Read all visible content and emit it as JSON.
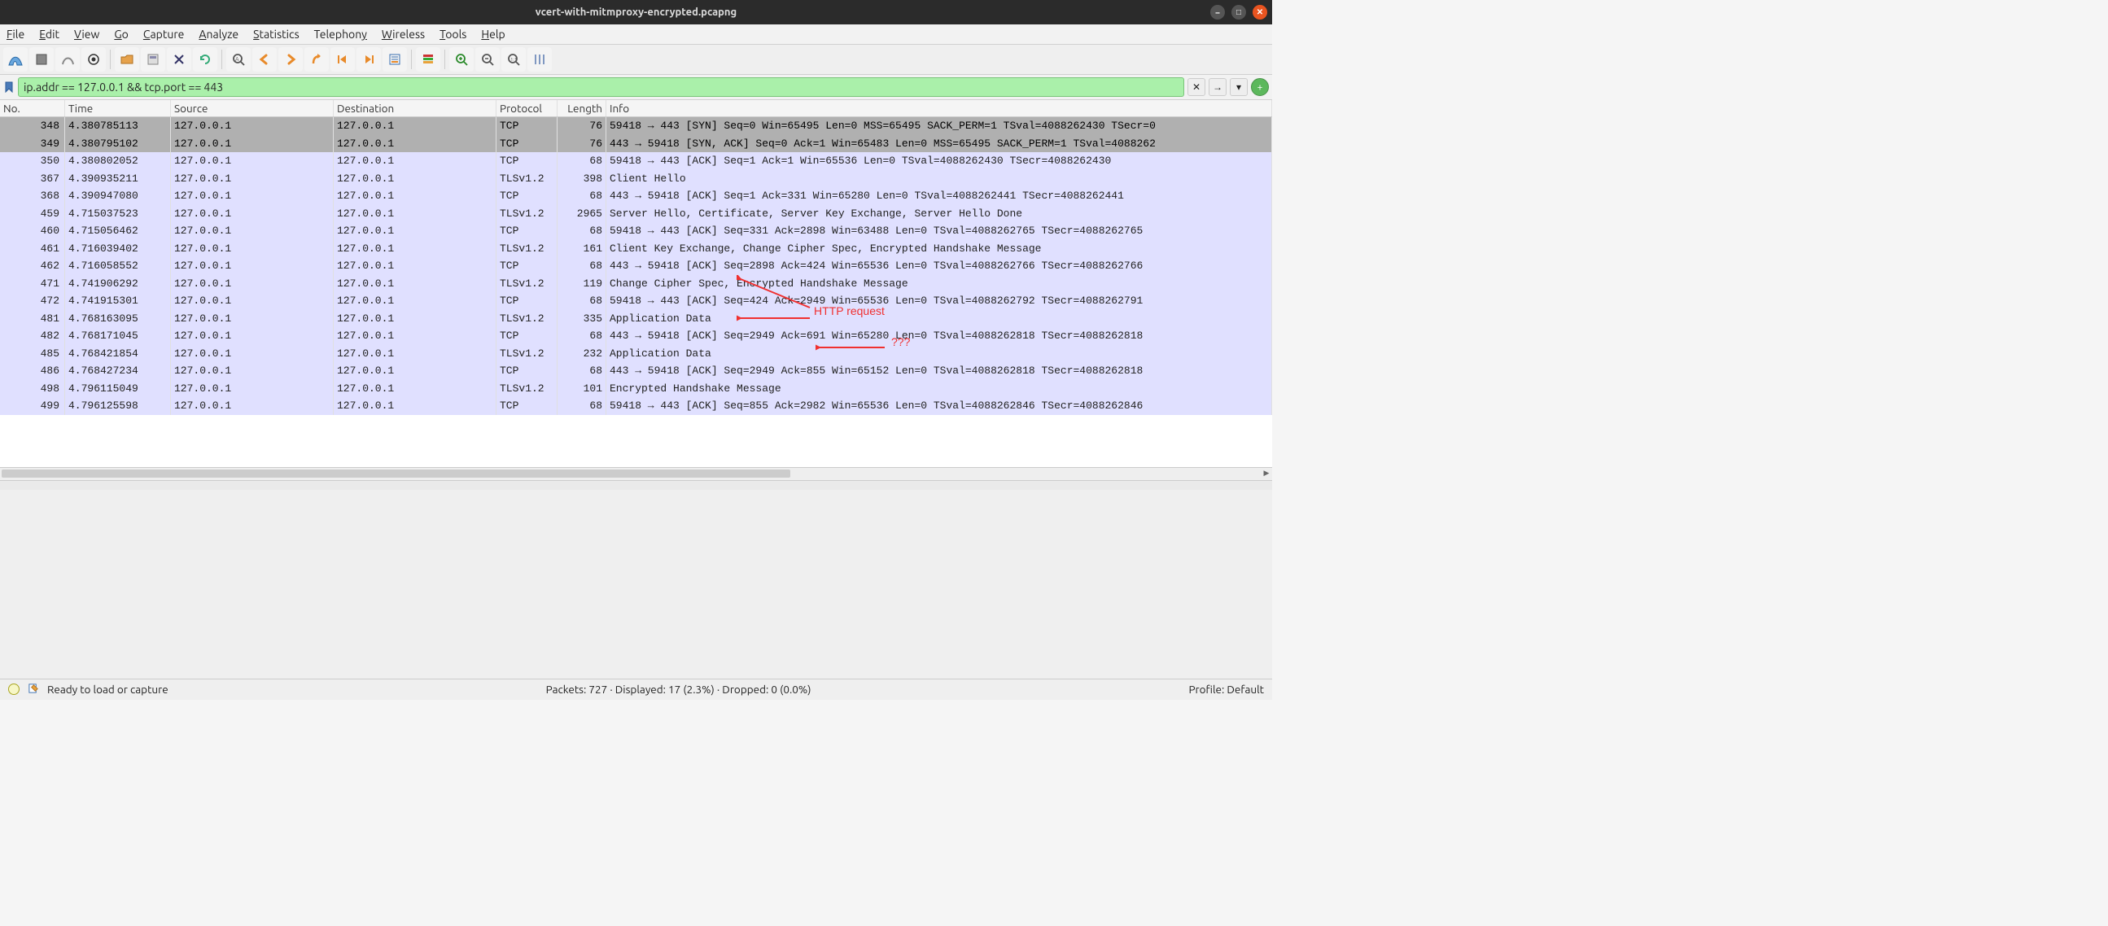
{
  "window": {
    "title": "vcert-with-mitmproxy-encrypted.pcapng"
  },
  "menu": {
    "items": [
      "File",
      "Edit",
      "View",
      "Go",
      "Capture",
      "Analyze",
      "Statistics",
      "Telephony",
      "Wireless",
      "Tools",
      "Help"
    ]
  },
  "filter": {
    "value": "ip.addr == 127.0.0.1 && tcp.port == 443"
  },
  "columns": [
    "No.",
    "Time",
    "Source",
    "Destination",
    "Protocol",
    "Length",
    "Info"
  ],
  "rows": [
    {
      "no": "348",
      "time": "4.380785113",
      "src": "127.0.0.1",
      "dst": "127.0.0.1",
      "proto": "TCP",
      "len": "76",
      "info": "59418 → 443 [SYN] Seq=0 Win=65495 Len=0 MSS=65495 SACK_PERM=1 TSval=4088262430 TSecr=0",
      "cls": "sel"
    },
    {
      "no": "349",
      "time": "4.380795102",
      "src": "127.0.0.1",
      "dst": "127.0.0.1",
      "proto": "TCP",
      "len": "76",
      "info": "443 → 59418 [SYN, ACK] Seq=0 Ack=1 Win=65483 Len=0 MSS=65495 SACK_PERM=1 TSval=4088262",
      "cls": "sel"
    },
    {
      "no": "350",
      "time": "4.380802052",
      "src": "127.0.0.1",
      "dst": "127.0.0.1",
      "proto": "TCP",
      "len": "68",
      "info": "59418 → 443 [ACK] Seq=1 Ack=1 Win=65536 Len=0 TSval=4088262430 TSecr=4088262430",
      "cls": "tcp"
    },
    {
      "no": "367",
      "time": "4.390935211",
      "src": "127.0.0.1",
      "dst": "127.0.0.1",
      "proto": "TLSv1.2",
      "len": "398",
      "info": "Client Hello",
      "cls": "tls"
    },
    {
      "no": "368",
      "time": "4.390947080",
      "src": "127.0.0.1",
      "dst": "127.0.0.1",
      "proto": "TCP",
      "len": "68",
      "info": "443 → 59418 [ACK] Seq=1 Ack=331 Win=65280 Len=0 TSval=4088262441 TSecr=4088262441",
      "cls": "tcp"
    },
    {
      "no": "459",
      "time": "4.715037523",
      "src": "127.0.0.1",
      "dst": "127.0.0.1",
      "proto": "TLSv1.2",
      "len": "2965",
      "info": "Server Hello, Certificate, Server Key Exchange, Server Hello Done",
      "cls": "tls"
    },
    {
      "no": "460",
      "time": "4.715056462",
      "src": "127.0.0.1",
      "dst": "127.0.0.1",
      "proto": "TCP",
      "len": "68",
      "info": "59418 → 443 [ACK] Seq=331 Ack=2898 Win=63488 Len=0 TSval=4088262765 TSecr=4088262765",
      "cls": "tcp"
    },
    {
      "no": "461",
      "time": "4.716039402",
      "src": "127.0.0.1",
      "dst": "127.0.0.1",
      "proto": "TLSv1.2",
      "len": "161",
      "info": "Client Key Exchange, Change Cipher Spec, Encrypted Handshake Message",
      "cls": "tls"
    },
    {
      "no": "462",
      "time": "4.716058552",
      "src": "127.0.0.1",
      "dst": "127.0.0.1",
      "proto": "TCP",
      "len": "68",
      "info": "443 → 59418 [ACK] Seq=2898 Ack=424 Win=65536 Len=0 TSval=4088262766 TSecr=4088262766",
      "cls": "tcp"
    },
    {
      "no": "471",
      "time": "4.741906292",
      "src": "127.0.0.1",
      "dst": "127.0.0.1",
      "proto": "TLSv1.2",
      "len": "119",
      "info": "Change Cipher Spec, Encrypted Handshake Message",
      "cls": "tls"
    },
    {
      "no": "472",
      "time": "4.741915301",
      "src": "127.0.0.1",
      "dst": "127.0.0.1",
      "proto": "TCP",
      "len": "68",
      "info": "59418 → 443 [ACK] Seq=424 Ack=2949 Win=65536 Len=0 TSval=4088262792 TSecr=4088262791",
      "cls": "tcp"
    },
    {
      "no": "481",
      "time": "4.768163095",
      "src": "127.0.0.1",
      "dst": "127.0.0.1",
      "proto": "TLSv1.2",
      "len": "335",
      "info": "Application Data",
      "cls": "tls"
    },
    {
      "no": "482",
      "time": "4.768171045",
      "src": "127.0.0.1",
      "dst": "127.0.0.1",
      "proto": "TCP",
      "len": "68",
      "info": "443 → 59418 [ACK] Seq=2949 Ack=691 Win=65280 Len=0 TSval=4088262818 TSecr=4088262818",
      "cls": "tcp"
    },
    {
      "no": "485",
      "time": "4.768421854",
      "src": "127.0.0.1",
      "dst": "127.0.0.1",
      "proto": "TLSv1.2",
      "len": "232",
      "info": "Application Data",
      "cls": "tls"
    },
    {
      "no": "486",
      "time": "4.768427234",
      "src": "127.0.0.1",
      "dst": "127.0.0.1",
      "proto": "TCP",
      "len": "68",
      "info": "443 → 59418 [ACK] Seq=2949 Ack=855 Win=65152 Len=0 TSval=4088262818 TSecr=4088262818",
      "cls": "tcp"
    },
    {
      "no": "498",
      "time": "4.796115049",
      "src": "127.0.0.1",
      "dst": "127.0.0.1",
      "proto": "TLSv1.2",
      "len": "101",
      "info": "Encrypted Handshake Message",
      "cls": "tls"
    },
    {
      "no": "499",
      "time": "4.796125598",
      "src": "127.0.0.1",
      "dst": "127.0.0.1",
      "proto": "TCP",
      "len": "68",
      "info": "59418 → 443 [ACK] Seq=855 Ack=2982 Win=65536 Len=0 TSval=4088262846 TSecr=4088262846",
      "cls": "tcp"
    }
  ],
  "status": {
    "ready": "Ready to load or capture",
    "stats": "Packets: 727 · Displayed: 17 (2.3%) · Dropped: 0 (0.0%)",
    "profile": "Profile: Default"
  },
  "annotations": {
    "a1": "HTTP request",
    "a2": "???"
  }
}
